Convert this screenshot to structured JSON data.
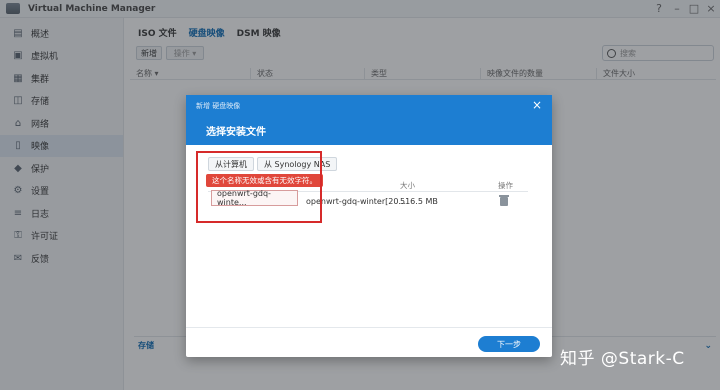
{
  "window": {
    "title": "Virtual Machine Manager",
    "help": "?",
    "minimize": "–",
    "maximize": "□",
    "close": "×"
  },
  "sidebar": {
    "items": [
      {
        "label": "概述",
        "icon": "overview-icon",
        "glyph": "▤"
      },
      {
        "label": "虚拟机",
        "icon": "virtual-machine-icon",
        "glyph": "▣"
      },
      {
        "label": "集群",
        "icon": "cluster-icon",
        "glyph": "▦"
      },
      {
        "label": "存储",
        "icon": "storage-icon",
        "glyph": "◫"
      },
      {
        "label": "网络",
        "icon": "network-icon",
        "glyph": "⌂"
      },
      {
        "label": "映像",
        "icon": "image-icon",
        "glyph": "▯"
      },
      {
        "label": "保护",
        "icon": "protection-icon",
        "glyph": "◆"
      },
      {
        "label": "设置",
        "icon": "settings-icon",
        "glyph": "⚙"
      },
      {
        "label": "日志",
        "icon": "log-icon",
        "glyph": "≡"
      },
      {
        "label": "许可证",
        "icon": "license-icon",
        "glyph": "⚿"
      },
      {
        "label": "反馈",
        "icon": "feedback-icon",
        "glyph": "✉"
      }
    ],
    "active_index": 5
  },
  "tabs": [
    {
      "label": "ISO 文件"
    },
    {
      "label": "硬盘映像"
    },
    {
      "label": "DSM 映像"
    }
  ],
  "toolbar": {
    "new_label": "新增",
    "action_label": "操作 ▾"
  },
  "search": {
    "placeholder": "搜索"
  },
  "table": {
    "columns": [
      {
        "label": "名称 ▾"
      },
      {
        "label": "状态"
      },
      {
        "label": "类型"
      },
      {
        "label": "映像文件的数量"
      },
      {
        "label": "文件大小"
      }
    ]
  },
  "bottom": {
    "label": "存储",
    "chevron": "⌄"
  },
  "modal": {
    "breadcrumb": "新增 硬盘映像",
    "close": "×",
    "title": "选择安装文件",
    "source_tabs": [
      {
        "label": "从计算机"
      },
      {
        "label": "从 Synology NAS"
      }
    ],
    "file_table": {
      "headers": [
        {
          "label": "大小"
        },
        {
          "label": "操作"
        }
      ],
      "row": {
        "name_input": "openwrt-gdq-winte...",
        "file_name": "openwrt-gdq-winter[20...",
        "size": "516.5 MB"
      }
    },
    "error_tip": "这个名称无效或含有无效字符。",
    "next_button": "下一步"
  },
  "watermark": "知乎 @Stark-C"
}
